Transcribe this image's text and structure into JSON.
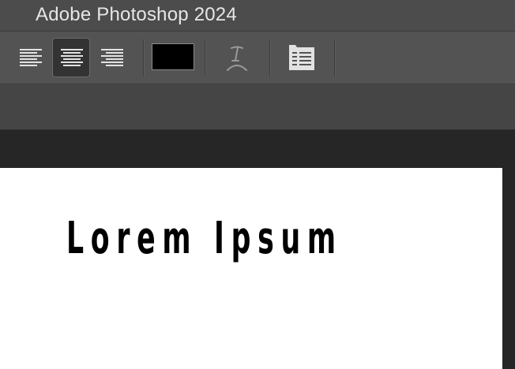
{
  "window": {
    "title": "Adobe Photoshop 2024"
  },
  "options_bar": {
    "align_buttons": [
      {
        "name": "align-left",
        "icon": "align-left-icon",
        "active": false
      },
      {
        "name": "align-center",
        "icon": "align-center-icon",
        "active": true
      },
      {
        "name": "align-right",
        "icon": "align-right-icon",
        "active": false
      }
    ],
    "text_color": "#000000",
    "warp_text_icon": "warp-text-icon",
    "panels_icon": "character-paragraph-panels-icon"
  },
  "document": {
    "text": "Lorem Ipsum"
  }
}
